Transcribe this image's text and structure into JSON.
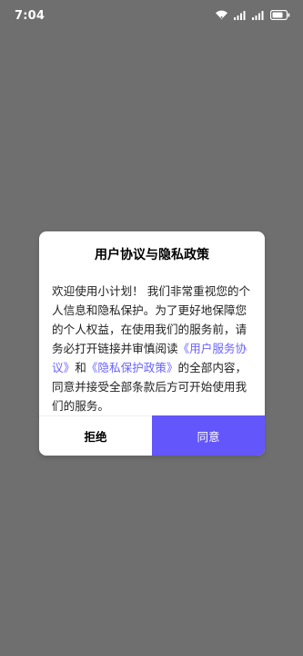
{
  "status_bar": {
    "time": "7:04",
    "icons": [
      "wifi-icon",
      "signal-icon",
      "signal-icon",
      "battery-icon"
    ]
  },
  "dialog": {
    "title": "用户协议与隐私政策",
    "body": {
      "intro": "欢迎使用小计划！  我们非常重视您的个人信息和隐私保护。为了更好地保障您的个人权益，在使用我们的服务前，请务必打开链接并审慎阅读",
      "link_terms": "《用户服务协议》",
      "and": "和",
      "link_privacy": "《隐私保护政策》",
      "outro": "的全部内容，同意并接受全部条款后方可开始使用我们的服务。"
    },
    "reject_label": "拒绝",
    "agree_label": "同意"
  },
  "colors": {
    "overlay": "#6f6f6f",
    "accent": "#6356fb",
    "link": "#6b63ff"
  }
}
